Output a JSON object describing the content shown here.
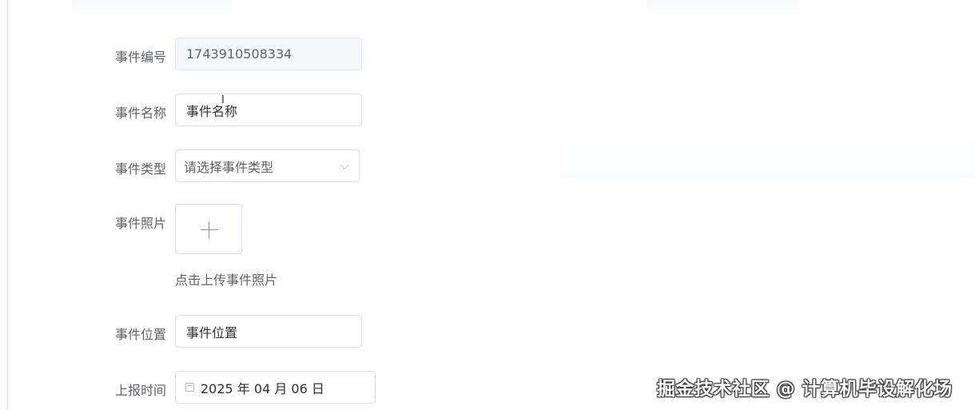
{
  "form": {
    "event_id": {
      "label": "事件编号",
      "value": "1743910508334"
    },
    "event_name": {
      "label": "事件名称",
      "placeholder": "事件名称"
    },
    "event_type": {
      "label": "事件类型",
      "placeholder": "请选择事件类型"
    },
    "event_photo": {
      "label": "事件照片",
      "hint": "点击上传事件照片"
    },
    "event_location": {
      "label": "事件位置",
      "placeholder": "事件位置"
    },
    "report_time": {
      "label": "上报时间",
      "value": "2025 年 04 月 06 日"
    }
  },
  "watermark": "掘金技术社区 @ 计算机毕设解化场"
}
